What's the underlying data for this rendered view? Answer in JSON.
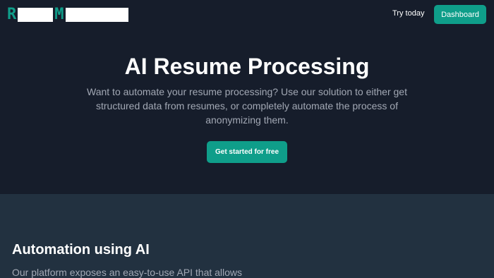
{
  "nav": {
    "logo_letters": [
      "R",
      "M"
    ],
    "try_label": "Try today",
    "dashboard_label": "Dashboard"
  },
  "hero": {
    "title": "AI Resume Processing",
    "subtitle": "Want to automate your resume processing? Use our solution to either get structured data from resumes, or completely automate the process of anonymizing them.",
    "cta_label": "Get started for free"
  },
  "section": {
    "title": "Automation using AI",
    "text": "Our platform exposes an easy-to-use API that allows"
  },
  "colors": {
    "hero_bg": "#161d2b",
    "section_bg": "#223140",
    "accent": "#0f9e8a",
    "muted_text": "#a2a8b4"
  }
}
